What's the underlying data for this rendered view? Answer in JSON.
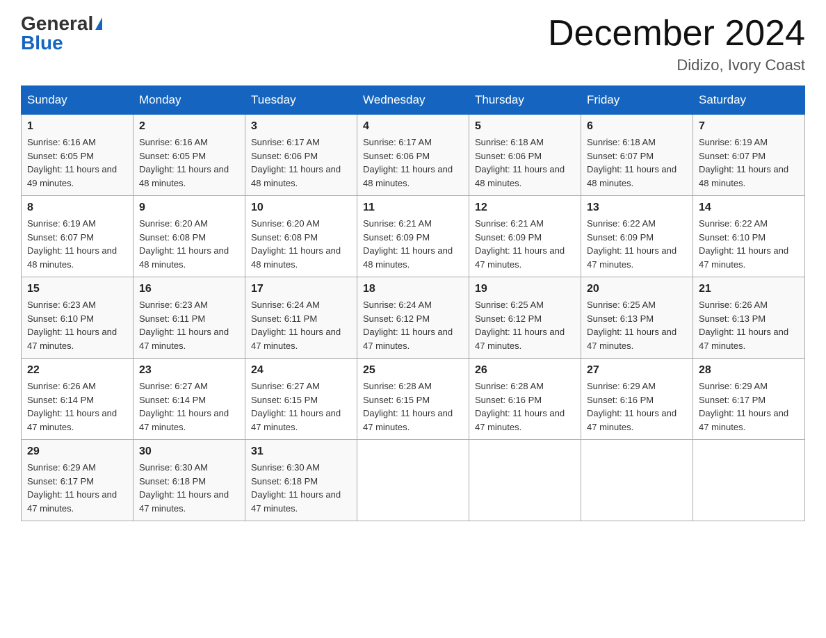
{
  "header": {
    "logo_general": "General",
    "logo_blue": "Blue",
    "month_title": "December 2024",
    "location": "Didizo, Ivory Coast"
  },
  "weekdays": [
    "Sunday",
    "Monday",
    "Tuesday",
    "Wednesday",
    "Thursday",
    "Friday",
    "Saturday"
  ],
  "weeks": [
    [
      {
        "day": "1",
        "sunrise": "6:16 AM",
        "sunset": "6:05 PM",
        "daylight": "11 hours and 49 minutes."
      },
      {
        "day": "2",
        "sunrise": "6:16 AM",
        "sunset": "6:05 PM",
        "daylight": "11 hours and 48 minutes."
      },
      {
        "day": "3",
        "sunrise": "6:17 AM",
        "sunset": "6:06 PM",
        "daylight": "11 hours and 48 minutes."
      },
      {
        "day": "4",
        "sunrise": "6:17 AM",
        "sunset": "6:06 PM",
        "daylight": "11 hours and 48 minutes."
      },
      {
        "day": "5",
        "sunrise": "6:18 AM",
        "sunset": "6:06 PM",
        "daylight": "11 hours and 48 minutes."
      },
      {
        "day": "6",
        "sunrise": "6:18 AM",
        "sunset": "6:07 PM",
        "daylight": "11 hours and 48 minutes."
      },
      {
        "day": "7",
        "sunrise": "6:19 AM",
        "sunset": "6:07 PM",
        "daylight": "11 hours and 48 minutes."
      }
    ],
    [
      {
        "day": "8",
        "sunrise": "6:19 AM",
        "sunset": "6:07 PM",
        "daylight": "11 hours and 48 minutes."
      },
      {
        "day": "9",
        "sunrise": "6:20 AM",
        "sunset": "6:08 PM",
        "daylight": "11 hours and 48 minutes."
      },
      {
        "day": "10",
        "sunrise": "6:20 AM",
        "sunset": "6:08 PM",
        "daylight": "11 hours and 48 minutes."
      },
      {
        "day": "11",
        "sunrise": "6:21 AM",
        "sunset": "6:09 PM",
        "daylight": "11 hours and 48 minutes."
      },
      {
        "day": "12",
        "sunrise": "6:21 AM",
        "sunset": "6:09 PM",
        "daylight": "11 hours and 47 minutes."
      },
      {
        "day": "13",
        "sunrise": "6:22 AM",
        "sunset": "6:09 PM",
        "daylight": "11 hours and 47 minutes."
      },
      {
        "day": "14",
        "sunrise": "6:22 AM",
        "sunset": "6:10 PM",
        "daylight": "11 hours and 47 minutes."
      }
    ],
    [
      {
        "day": "15",
        "sunrise": "6:23 AM",
        "sunset": "6:10 PM",
        "daylight": "11 hours and 47 minutes."
      },
      {
        "day": "16",
        "sunrise": "6:23 AM",
        "sunset": "6:11 PM",
        "daylight": "11 hours and 47 minutes."
      },
      {
        "day": "17",
        "sunrise": "6:24 AM",
        "sunset": "6:11 PM",
        "daylight": "11 hours and 47 minutes."
      },
      {
        "day": "18",
        "sunrise": "6:24 AM",
        "sunset": "6:12 PM",
        "daylight": "11 hours and 47 minutes."
      },
      {
        "day": "19",
        "sunrise": "6:25 AM",
        "sunset": "6:12 PM",
        "daylight": "11 hours and 47 minutes."
      },
      {
        "day": "20",
        "sunrise": "6:25 AM",
        "sunset": "6:13 PM",
        "daylight": "11 hours and 47 minutes."
      },
      {
        "day": "21",
        "sunrise": "6:26 AM",
        "sunset": "6:13 PM",
        "daylight": "11 hours and 47 minutes."
      }
    ],
    [
      {
        "day": "22",
        "sunrise": "6:26 AM",
        "sunset": "6:14 PM",
        "daylight": "11 hours and 47 minutes."
      },
      {
        "day": "23",
        "sunrise": "6:27 AM",
        "sunset": "6:14 PM",
        "daylight": "11 hours and 47 minutes."
      },
      {
        "day": "24",
        "sunrise": "6:27 AM",
        "sunset": "6:15 PM",
        "daylight": "11 hours and 47 minutes."
      },
      {
        "day": "25",
        "sunrise": "6:28 AM",
        "sunset": "6:15 PM",
        "daylight": "11 hours and 47 minutes."
      },
      {
        "day": "26",
        "sunrise": "6:28 AM",
        "sunset": "6:16 PM",
        "daylight": "11 hours and 47 minutes."
      },
      {
        "day": "27",
        "sunrise": "6:29 AM",
        "sunset": "6:16 PM",
        "daylight": "11 hours and 47 minutes."
      },
      {
        "day": "28",
        "sunrise": "6:29 AM",
        "sunset": "6:17 PM",
        "daylight": "11 hours and 47 minutes."
      }
    ],
    [
      {
        "day": "29",
        "sunrise": "6:29 AM",
        "sunset": "6:17 PM",
        "daylight": "11 hours and 47 minutes."
      },
      {
        "day": "30",
        "sunrise": "6:30 AM",
        "sunset": "6:18 PM",
        "daylight": "11 hours and 47 minutes."
      },
      {
        "day": "31",
        "sunrise": "6:30 AM",
        "sunset": "6:18 PM",
        "daylight": "11 hours and 47 minutes."
      },
      null,
      null,
      null,
      null
    ]
  ],
  "labels": {
    "sunrise_prefix": "Sunrise: ",
    "sunset_prefix": "Sunset: ",
    "daylight_prefix": "Daylight: "
  }
}
